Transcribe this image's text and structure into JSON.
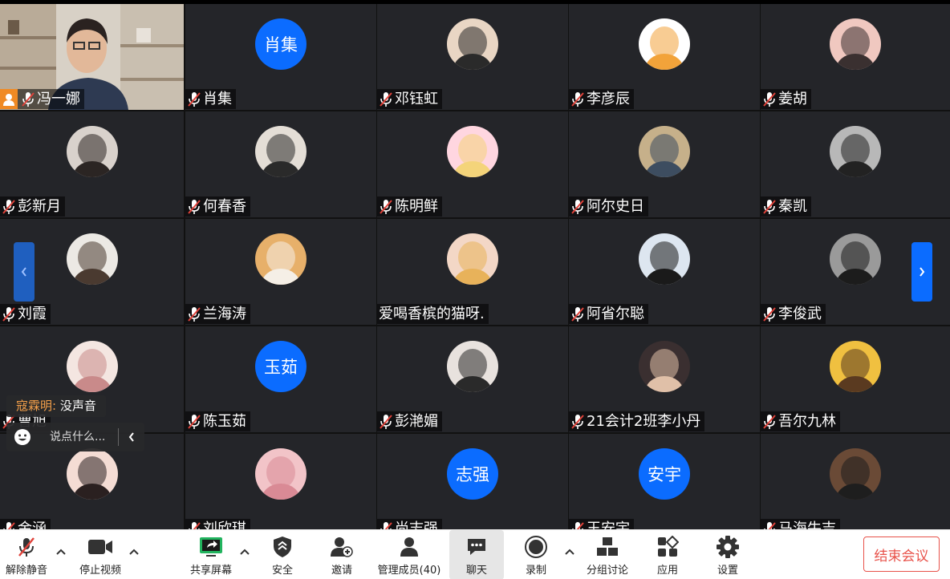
{
  "meeting": {
    "participants_row1": [
      {
        "name": "冯一娜",
        "type": "video",
        "host": true
      },
      {
        "name": "肖集",
        "type": "text",
        "avatar_text": "肖集"
      },
      {
        "name": "邓钰虹",
        "type": "photo",
        "c1": "#e9d6c4",
        "c2": "#2a2a2a"
      },
      {
        "name": "李彦辰",
        "type": "photo",
        "c1": "#ffffff",
        "c2": "#f2a33a"
      },
      {
        "name": "姜胡",
        "type": "photo",
        "c1": "#f0c8c0",
        "c2": "#3a3030"
      }
    ],
    "participants_row2": [
      {
        "name": "彭新月",
        "type": "photo",
        "c1": "#d9d2cc",
        "c2": "#2b2523"
      },
      {
        "name": "何春香",
        "type": "photo",
        "c1": "#e4ded6",
        "c2": "#2a2a2a"
      },
      {
        "name": "陈明鲜",
        "type": "photo",
        "c1": "#ffd6e0",
        "c2": "#f4d47a"
      },
      {
        "name": "阿尔史日",
        "type": "photo",
        "c1": "#c6b08a",
        "c2": "#3d4d60"
      },
      {
        "name": "秦凯",
        "type": "photo",
        "c1": "#b8b8b8",
        "c2": "#222222"
      }
    ],
    "participants_row3": [
      {
        "name": "刘霞",
        "type": "photo",
        "c1": "#ece9e4",
        "c2": "#4a3a30"
      },
      {
        "name": "兰海涛",
        "type": "photo",
        "c1": "#e7b06a",
        "c2": "#f5efe6"
      },
      {
        "name": "爱喝香槟的猫呀.",
        "type": "photo",
        "c1": "#f3d7c6",
        "c2": "#e8b25a",
        "no_mic": true
      },
      {
        "name": "阿省尔聪",
        "type": "photo",
        "c1": "#dde6f0",
        "c2": "#1a1a1a"
      },
      {
        "name": "李俊武",
        "type": "photo",
        "c1": "#9a9a9a",
        "c2": "#1c1c1c"
      }
    ],
    "participants_row4": [
      {
        "name": "曹旭",
        "type": "photo",
        "c1": "#f4e6e1",
        "c2": "#c98a8a"
      },
      {
        "name": "陈玉茹",
        "type": "text",
        "avatar_text": "玉茹"
      },
      {
        "name": "彭滟媚",
        "type": "photo",
        "c1": "#e8e2de",
        "c2": "#2a2a2a"
      },
      {
        "name": "21会计2班李小丹",
        "type": "photo",
        "c1": "#3a2f30",
        "c2": "#e0c0a8"
      },
      {
        "name": "吾尔九林",
        "type": "photo",
        "c1": "#f0c040",
        "c2": "#5a3a20"
      }
    ],
    "participants_row5": [
      {
        "name": "金涵",
        "type": "photo",
        "c1": "#f4dcd4",
        "c2": "#2a2020"
      },
      {
        "name": "刘欣琪",
        "type": "photo",
        "c1": "#f2c4c8",
        "c2": "#d98a95"
      },
      {
        "name": "尚志强",
        "type": "text",
        "avatar_text": "志强"
      },
      {
        "name": "王安宇",
        "type": "text",
        "avatar_text": "安宇"
      },
      {
        "name": "马海牛吉",
        "type": "photo",
        "c1": "#6a4a36",
        "c2": "#1e1e1e"
      }
    ],
    "row5_names_visible": [
      "金涵",
      "刘欣琪",
      "尚志强",
      "王安宇",
      "马海牛吉"
    ]
  },
  "chat": {
    "sender": "寇霖明:",
    "message": "没声音",
    "input_placeholder": "说点什么..."
  },
  "toolbar": {
    "unmute": "解除静音",
    "stop_video": "停止视频",
    "share_screen": "共享屏幕",
    "security": "安全",
    "invite": "邀请",
    "participants": "管理成员(40)",
    "chat": "聊天",
    "record": "录制",
    "breakout": "分组讨论",
    "apps": "应用",
    "settings": "设置",
    "end_meeting": "结束会议"
  },
  "colors": {
    "accent": "#0b6cff",
    "end_red": "#e8524a",
    "share_green": "#22b35e",
    "host_orange": "#f08a24",
    "muted_red": "#e0423a"
  }
}
